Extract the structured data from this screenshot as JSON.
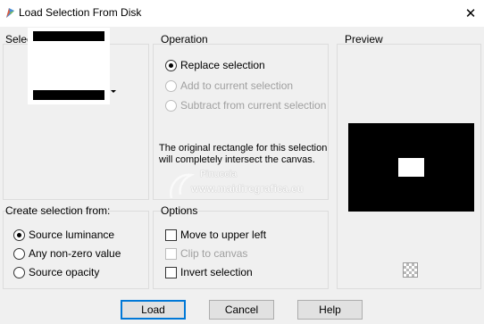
{
  "window": {
    "title": "Load Selection From Disk",
    "close_glyph": "✕"
  },
  "selection_group": {
    "label": "Selection"
  },
  "operation_group": {
    "label": "Operation",
    "options": [
      {
        "label": "Replace selection",
        "checked": true,
        "enabled": true
      },
      {
        "label": "Add to current selection",
        "checked": false,
        "enabled": false
      },
      {
        "label": "Subtract from current selection",
        "checked": false,
        "enabled": false
      }
    ],
    "info_text": "The original rectangle for this selection will completely intersect the canvas."
  },
  "preview_group": {
    "label": "Preview",
    "checker_icon": "transparency-icon"
  },
  "create_from_group": {
    "label": "Create selection from:",
    "options": [
      {
        "label": "Source luminance",
        "checked": true
      },
      {
        "label": "Any non-zero value",
        "checked": false
      },
      {
        "label": "Source opacity",
        "checked": false
      }
    ]
  },
  "options_group": {
    "label": "Options",
    "items": [
      {
        "label": "Move to upper left",
        "checked": false,
        "enabled": true
      },
      {
        "label": "Clip to canvas",
        "checked": false,
        "enabled": false
      },
      {
        "label": "Invert selection",
        "checked": false,
        "enabled": true
      }
    ]
  },
  "watermark": {
    "name": "Pinuccia",
    "url": "www.maidiregrafica.eu"
  },
  "buttons": {
    "load": "Load",
    "cancel": "Cancel",
    "help": "Help"
  },
  "colors": {
    "dialog_bg": "#f0f0f0",
    "default_button_border": "#0078d7",
    "disabled_text": "#a0a0a0"
  }
}
